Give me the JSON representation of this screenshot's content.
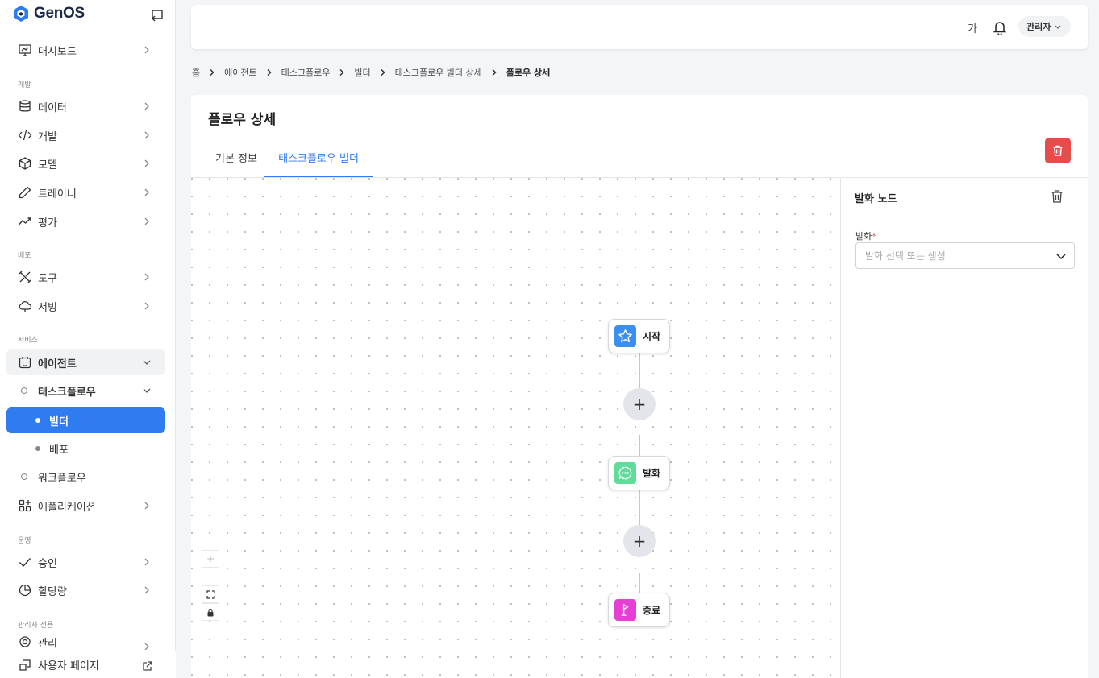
{
  "app": {
    "name": "GenOS"
  },
  "sidebar": {
    "items": {
      "dashboard": "대시보드",
      "data": "데이터",
      "dev": "개발",
      "model": "모델",
      "trainer": "트레이너",
      "eval": "평가",
      "tools": "도구",
      "serving": "서빙",
      "agent": "에이전트",
      "taskflow": "태스크플로우",
      "builder": "빌더",
      "deploy": "배포",
      "workflow": "워크플로우",
      "application": "애플리케이션",
      "approval": "승인",
      "quota": "할당량",
      "admin": "관리"
    },
    "sections": {
      "dev": "개발",
      "deploy": "배포",
      "service": "서비스",
      "ops": "운영",
      "admin_only": "관리자 전용"
    },
    "footer": "사용자 페이지"
  },
  "header": {
    "lang": "가",
    "user": "관리자"
  },
  "breadcrumb": [
    "홈",
    "에이전트",
    "태스크플로우",
    "빌더",
    "태스크플로우 빌더 상세",
    "플로우 상세"
  ],
  "page": {
    "title": "플로우 상세",
    "tabs": [
      "기본 정보",
      "태스크플로우 빌더"
    ],
    "active_tab": "태스크플로우 빌더"
  },
  "flow": {
    "nodes": [
      {
        "label": "시작",
        "icon": "star-icon",
        "color": "#3b8ff0"
      },
      {
        "label": "발화",
        "icon": "chat-icon",
        "color": "#5fdc9a"
      },
      {
        "label": "종료",
        "icon": "flag-icon",
        "color": "#e63fd3"
      }
    ],
    "add_symbol": "+",
    "zoom_controls": {
      "zoom_in": "+",
      "zoom_out": "—"
    }
  },
  "node_panel": {
    "title": "발화 노드",
    "field_label": "발화",
    "required_mark": "*",
    "placeholder": "발화 선택 또는 생성"
  },
  "colors": {
    "accent": "#2f7bf0",
    "danger": "#e84b4b"
  }
}
